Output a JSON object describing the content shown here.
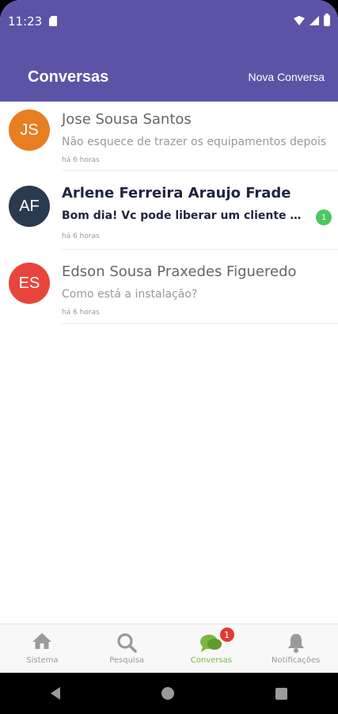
{
  "status": {
    "time": "11:23"
  },
  "header": {
    "title": "Conversas",
    "new_conversation_label": "Nova Conversa"
  },
  "conversations": [
    {
      "initials": "JS",
      "avatar_color": "#e87e22",
      "name": "Jose Sousa Santos",
      "preview": "Não esquece de trazer os equipamentos depois",
      "time": "há 6 horas",
      "unread": ""
    },
    {
      "initials": "AF",
      "avatar_color": "#2b3a4f",
      "name": "Arlene Ferreira Araujo Frade",
      "preview": "Bom dia! Vc pode liberar um cliente pra mim?",
      "time": "há 6 horas",
      "unread": "1"
    },
    {
      "initials": "ES",
      "avatar_color": "#e8453c",
      "name": "Edson Sousa Praxedes Figueredo",
      "preview": "Como está a instalação?",
      "time": "há 6 horas",
      "unread": ""
    }
  ],
  "bottom_nav": {
    "items": [
      {
        "label": "Sistema",
        "icon": "home-icon"
      },
      {
        "label": "Pesquisa",
        "icon": "search-icon"
      },
      {
        "label": "Conversas",
        "icon": "chat-icon",
        "badge": "1"
      },
      {
        "label": "Notificações",
        "icon": "bell-icon"
      }
    ],
    "active_color": "#7ab83b"
  },
  "colors": {
    "header": "#5b54a6",
    "unread_badge": "#4cc760",
    "nav_badge": "#e53935"
  }
}
